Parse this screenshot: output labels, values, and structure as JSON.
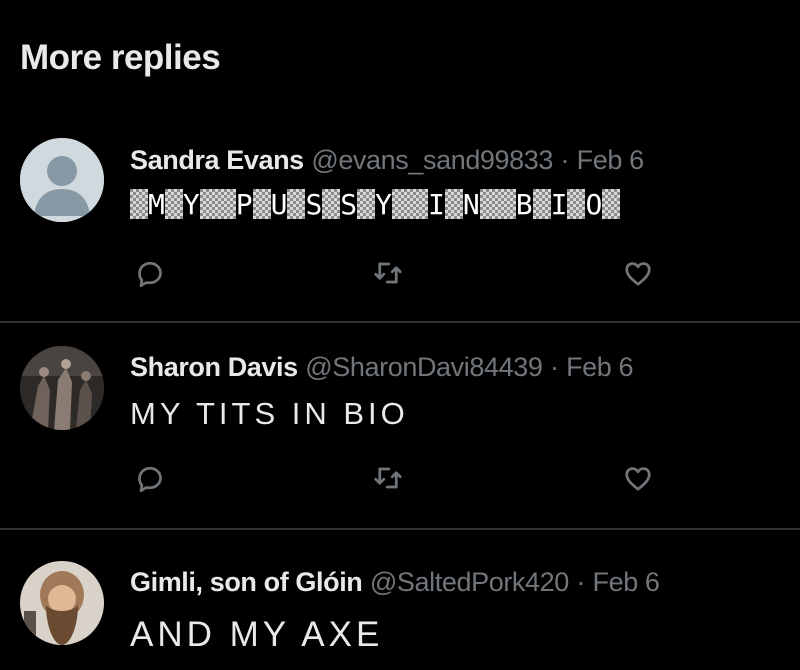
{
  "section": {
    "title": "More replies"
  },
  "replies": [
    {
      "name": "Sandra Evans",
      "handle": "@evans_sand99833",
      "separator": "·",
      "date": "Feb 6",
      "text": "MY PUSSY IN BIO",
      "text_style": "glitched",
      "glitch_parts": [
        "",
        "M",
        "Y",
        "",
        "P",
        "U",
        "S",
        "S",
        "Y",
        "",
        "I",
        "N",
        "",
        "B",
        "I",
        "O",
        ""
      ],
      "avatar": "default-profile-avatar"
    },
    {
      "name": "Sharon Davis",
      "handle": "@SharonDavi84439",
      "separator": "·",
      "date": "Feb 6",
      "text": "MY TITS IN BIO",
      "text_style": "spaced",
      "avatar": "photo-avatar"
    },
    {
      "name": "Gimli, son of Glóin",
      "handle": "@SaltedPork420",
      "separator": "·",
      "date": "Feb 6",
      "text": "AND MY AXE",
      "text_style": "spaced",
      "avatar": "photo-avatar"
    }
  ],
  "icons": {
    "reply": "speech-bubble-icon",
    "retweet": "retweet-arrows-icon",
    "like": "heart-icon"
  },
  "colors": {
    "background": "#000000",
    "primary_text": "#e7e9ea",
    "secondary_text": "#71767b",
    "divider": "#2f3336"
  }
}
